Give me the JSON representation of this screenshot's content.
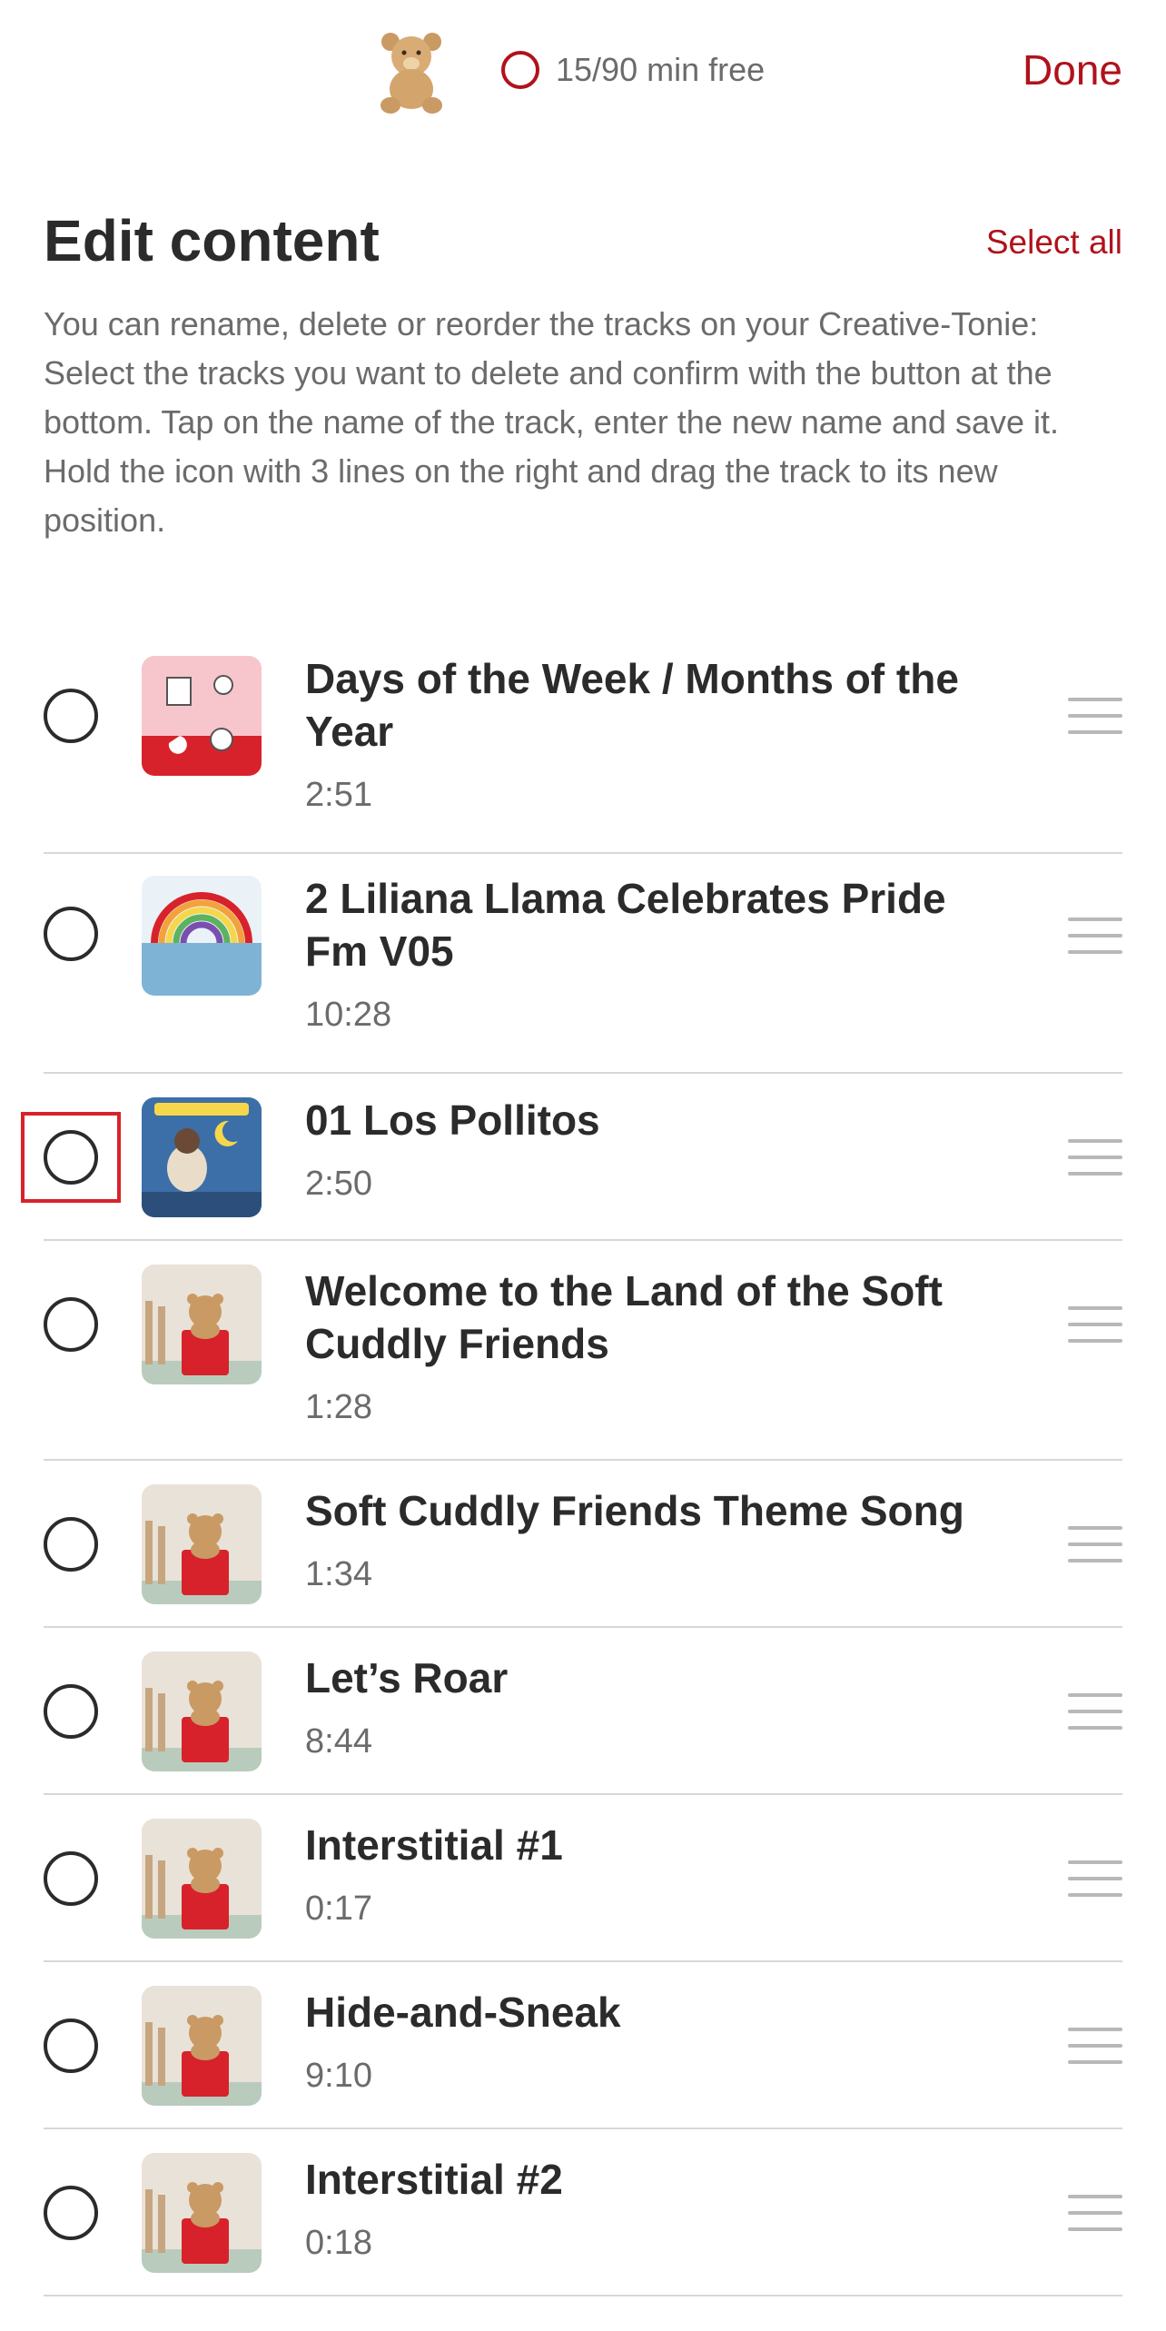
{
  "header": {
    "capacity_text": "15/90 min free",
    "done_label": "Done"
  },
  "page": {
    "title": "Edit content",
    "select_all_label": "Select all",
    "description": "You can rename, delete or reorder the tracks on your Creative-Tonie: Select the tracks you want to delete and confirm with the button at the bottom. Tap on the name of the track, enter the new name and save it. Hold the icon with 3 lines on the right and drag the track to its new position."
  },
  "tracks": [
    {
      "title": "Days of the Week / Months of the Year",
      "duration": "2:51",
      "thumb": "calendar-art"
    },
    {
      "title": "2 Liliana Llama Celebrates Pride Fm V05",
      "duration": "10:28",
      "thumb": "rainbow-art"
    },
    {
      "title": "01 Los Pollitos",
      "duration": "2:50",
      "thumb": "lullabies-art"
    },
    {
      "title": "Welcome to the Land of the Soft Cuddly Friends",
      "duration": "1:28",
      "thumb": "bear-box"
    },
    {
      "title": "Soft Cuddly Friends Theme Song",
      "duration": "1:34",
      "thumb": "bear-box"
    },
    {
      "title": "Let’s Roar",
      "duration": "8:44",
      "thumb": "bear-box"
    },
    {
      "title": "Interstitial #1",
      "duration": "0:17",
      "thumb": "bear-box"
    },
    {
      "title": "Hide-and-Sneak",
      "duration": "9:10",
      "thumb": "bear-box"
    },
    {
      "title": "Interstitial #2",
      "duration": "0:18",
      "thumb": "bear-box"
    }
  ],
  "colors": {
    "accent": "#b0121b",
    "text": "#2b2b2b",
    "muted": "#6b6b6b",
    "divider": "#d7d7d7"
  }
}
